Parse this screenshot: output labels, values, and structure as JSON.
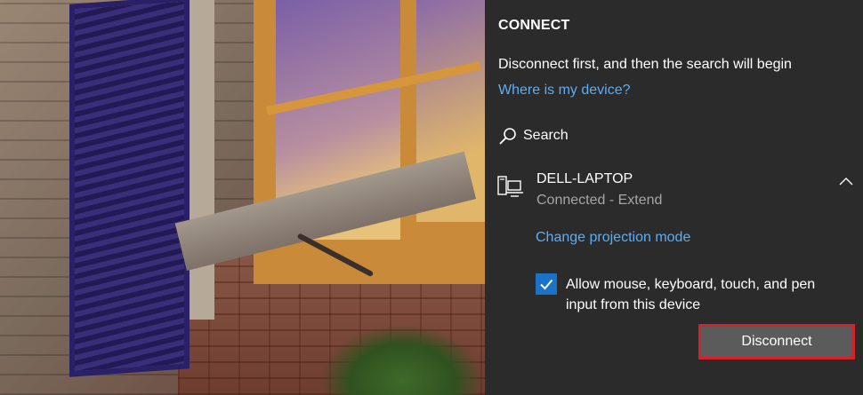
{
  "panel": {
    "title": "CONNECT",
    "status_text": "Disconnect first, and then the search will begin",
    "help_link": "Where is my device?",
    "search_label": "Search",
    "search_icon": "search-icon",
    "device": {
      "name": "DELL-LAPTOP",
      "status": "Connected - Extend",
      "icon": "laptop-display-icon",
      "expanded": true
    },
    "projection_link": "Change projection mode",
    "allow_input": {
      "checked": true,
      "label": "Allow mouse, keyboard, touch, and pen input from this device"
    },
    "disconnect_label": "Disconnect"
  },
  "colors": {
    "panel_bg": "#2b2b2b",
    "accent_link": "#5aaef5",
    "checkbox_accent": "#1a73c8",
    "secondary_text": "#a6a6a6",
    "button_bg": "#5b5b5b",
    "button_highlight": "#d4212a"
  }
}
